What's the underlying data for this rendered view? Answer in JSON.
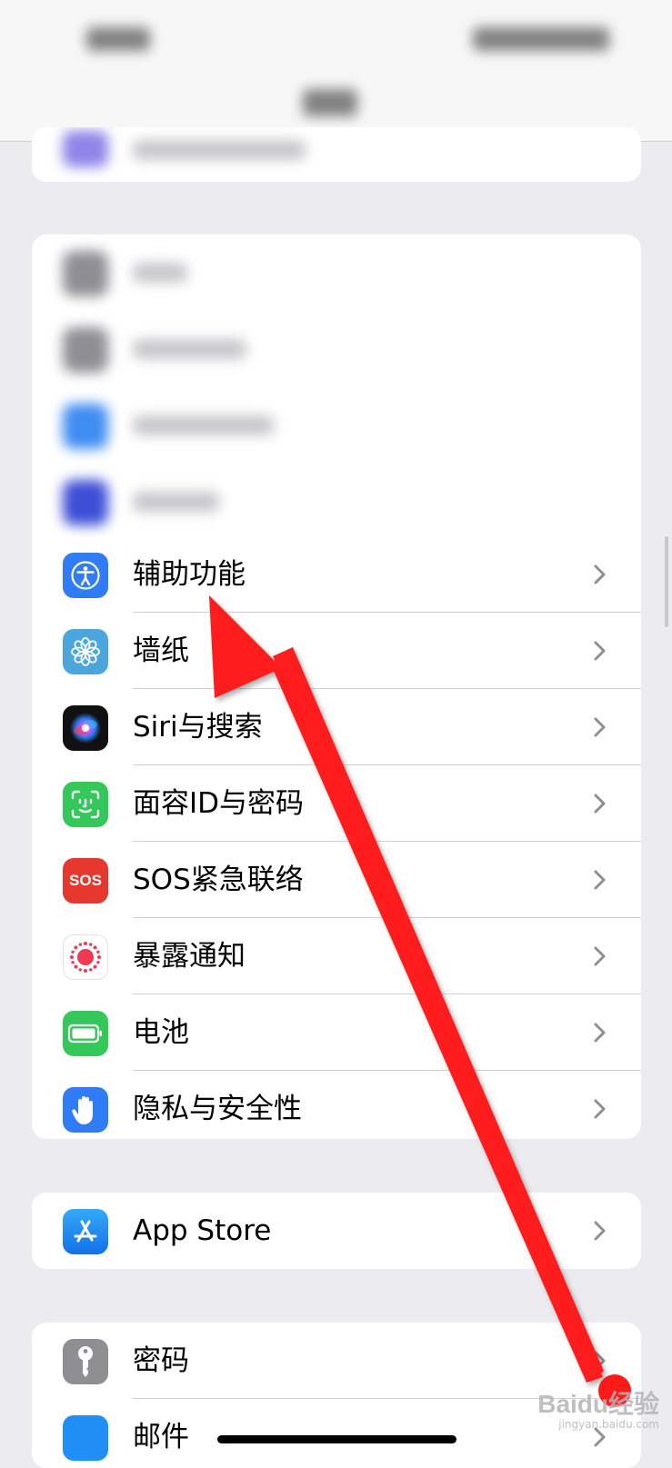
{
  "header": {
    "time": "",
    "title": ""
  },
  "settings": {
    "group1": {
      "items": [
        {
          "label": "辅助功能",
          "icon": "accessibility-icon"
        },
        {
          "label": "墙纸",
          "icon": "wallpaper-flower-icon"
        },
        {
          "label": "Siri与搜索",
          "icon": "siri-icon"
        },
        {
          "label": "面容ID与密码",
          "icon": "face-id-icon"
        },
        {
          "label": "SOS紧急联络",
          "icon": "sos-icon",
          "icon_text": "SOS"
        },
        {
          "label": "暴露通知",
          "icon": "exposure-notification-icon"
        },
        {
          "label": "电池",
          "icon": "battery-icon"
        },
        {
          "label": "隐私与安全性",
          "icon": "privacy-hand-icon"
        }
      ]
    },
    "group2": {
      "items": [
        {
          "label": "App Store",
          "icon": "app-store-icon"
        }
      ]
    },
    "group3": {
      "items": [
        {
          "label": "密码",
          "icon": "key-icon"
        },
        {
          "label": "邮件",
          "icon": "mail-icon"
        }
      ]
    }
  },
  "colors": {
    "accessibility": "#2f7cf6",
    "wallpaper": "#4aa6dc",
    "face_id": "#34c759",
    "sos": "#e5392f",
    "battery": "#34c759",
    "privacy": "#2f7cf6",
    "app_store": "#1f8ff5",
    "passwords": "#8e8e93",
    "annotation_arrow": "#ff1a1a"
  },
  "watermark": {
    "text": "Baidu经验",
    "sub": "jingyan.baidu.com"
  }
}
